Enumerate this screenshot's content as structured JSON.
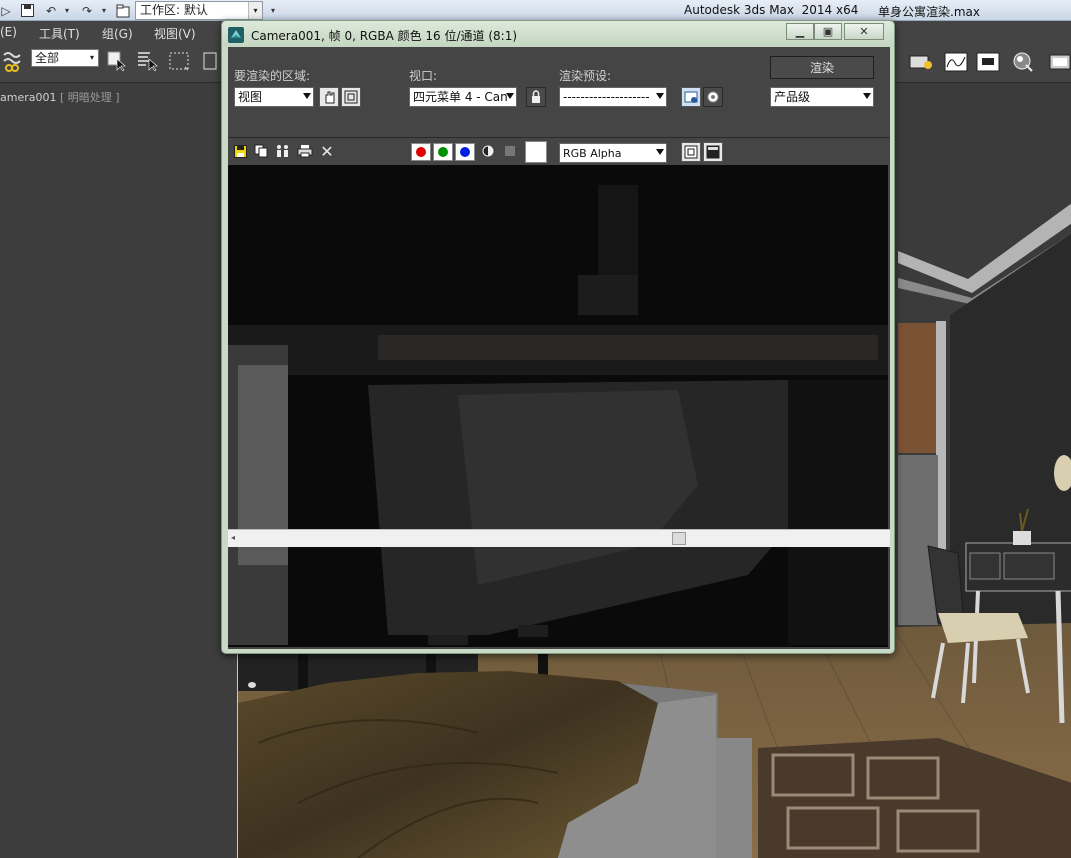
{
  "app": {
    "title": "Autodesk 3ds Max  2014 x64",
    "file": "单身公寓渲染.max",
    "workspace_label": "工作区: 默认"
  },
  "menu": {
    "items": [
      "(E)",
      "工具(T)",
      "组(G)",
      "视图(V)"
    ]
  },
  "toolbar": {
    "selection_filter": "全部"
  },
  "viewport": {
    "label_name": "amera001",
    "label_shading": "[ 明暗处理 ]"
  },
  "render_window": {
    "caption": "Camera001, 帧 0, RGBA 颜色 16 位/通道 (8:1)",
    "area_label": "要渲染的区域:",
    "area_value": "视图",
    "viewport_label": "视口:",
    "viewport_value": "四元菜单 4 - Can",
    "preset_label": "渲染预设:",
    "preset_value": "--------------------",
    "render_button": "渲染",
    "quality_value": "产品级",
    "channel_value": "RGB Alpha"
  },
  "colors": {
    "red_channel": "#e00000",
    "green_channel": "#009000",
    "blue_channel": "#0020e0",
    "viewport_border": "#e6d25a"
  }
}
